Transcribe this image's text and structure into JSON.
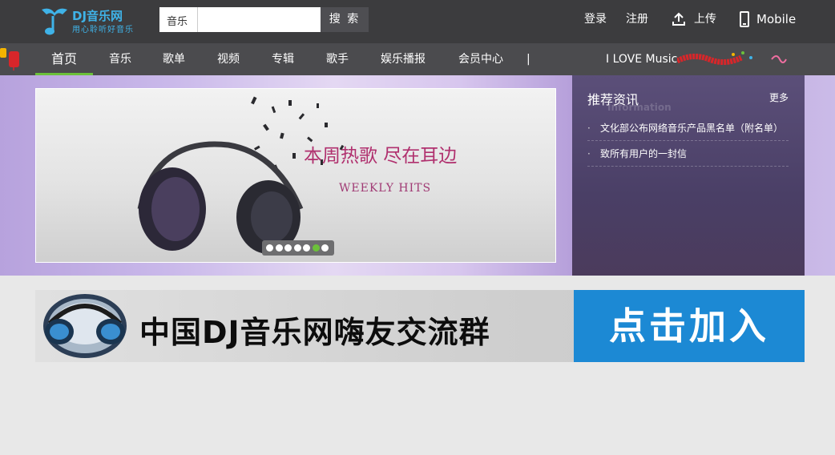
{
  "logo": {
    "brand": "DJ音乐网",
    "slogan": "用心聆听好音乐"
  },
  "search": {
    "category": "音乐",
    "placeholder": "",
    "button": "搜 索"
  },
  "top_links": {
    "login": "登录",
    "register": "注册",
    "upload": "上传",
    "mobile": "Mobile"
  },
  "nav": {
    "items": [
      "首页",
      "音乐",
      "歌单",
      "视频",
      "专辑",
      "歌手",
      "娱乐播报",
      "会员中心"
    ],
    "separator": "|",
    "tagline": "I LOVE Music"
  },
  "banner": {
    "headline": "本周热歌 尽在耳边",
    "sub": "WEEKLY HITS",
    "slide_count": 7,
    "active_slide": 6
  },
  "news": {
    "title": "推荐资讯",
    "ghost": "Information",
    "more": "更多",
    "items": [
      "文化部公布网络音乐产品黑名单（附名单）",
      "致所有用户的一封信"
    ]
  },
  "join": {
    "text": "中国DJ音乐网嗨友交流群",
    "cta": "点击加入"
  },
  "colors": {
    "accent_green": "#6cc13a",
    "brand_blue": "#3fb3e8",
    "cta_blue": "#1c89d4",
    "headline_pink": "#b0306e"
  }
}
